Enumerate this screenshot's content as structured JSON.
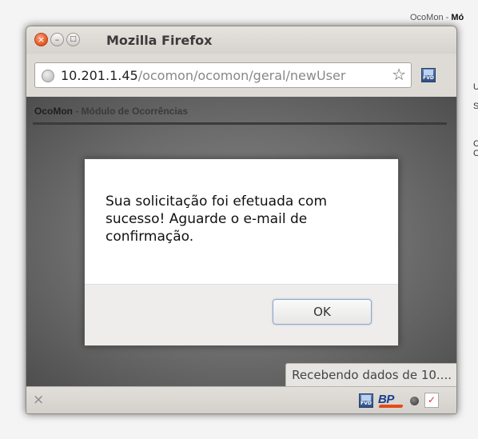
{
  "background_page": {
    "title_prefix": "OcoMon - ",
    "title_bold": "Mó",
    "side_fragments": [
      "U",
      "S",
      "C",
      "C"
    ]
  },
  "window": {
    "title": "Mozilla Firefox",
    "url_host": "10.201.1.45",
    "url_path": "/ocomon/ocomon/geral/newUser",
    "fvd_label": "FVD"
  },
  "page": {
    "header_app": "OcoMon",
    "header_sep": " - ",
    "header_module": "Módulo de Ocorrências"
  },
  "dialog": {
    "message": "Sua solicitação foi efetuada com sucesso! Aguarde o e-mail de confirmação.",
    "ok_label": "OK"
  },
  "status": {
    "text": "Recebendo dados de 10...."
  },
  "addon_bar": {
    "close_glyph": "×",
    "bp_label": "BP"
  }
}
